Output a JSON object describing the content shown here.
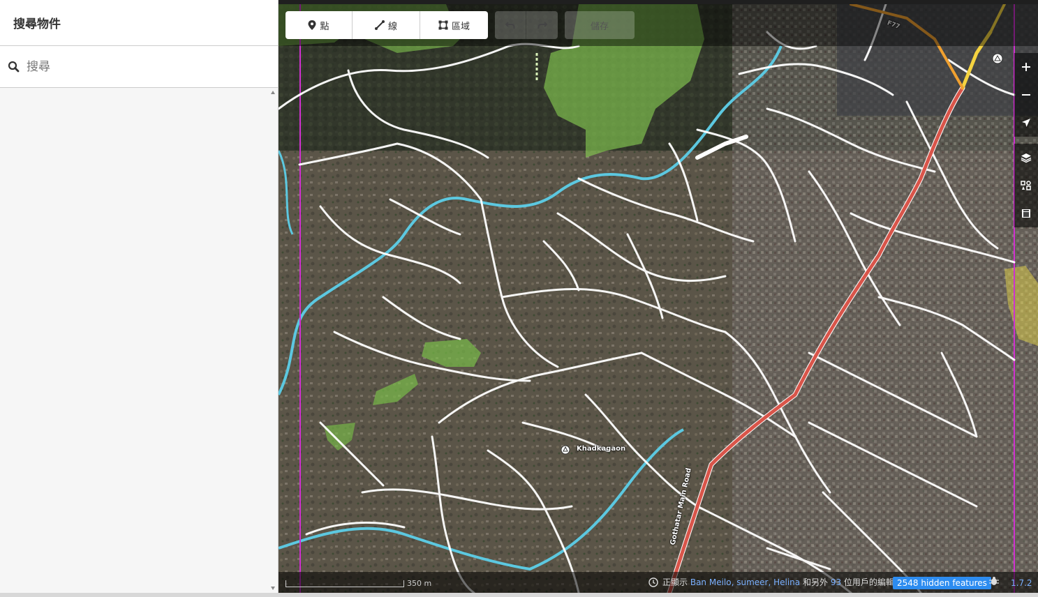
{
  "sidebar": {
    "title": "搜尋物件",
    "search_placeholder": "搜尋"
  },
  "toolbar": {
    "point_label": "點",
    "line_label": "線",
    "area_label": "區域",
    "save_label": "儲存"
  },
  "map": {
    "place_name": "Khadkagaon",
    "road_name": "Gothatar Main Road",
    "road_ref": "F77",
    "colors": {
      "primary_road": "#d9554a",
      "trunk_road": "#f5d340",
      "river": "#5cc8e0",
      "park": "#8bd354",
      "boundary": "#d030d0",
      "minor_road": "#ffffff"
    }
  },
  "footer": {
    "scale_label": "350 m",
    "attribution_prefix": "正顯示",
    "attribution_users": "Ban Meilo, sumeer, Helina",
    "attribution_middle": "和另外",
    "attribution_count": "93",
    "attribution_suffix": "位用戶的編輯",
    "hidden_features": "2548 hidden features",
    "version": "1.7.2"
  },
  "icons": {
    "search": "search-icon",
    "point": "point-icon",
    "line": "line-icon",
    "area": "area-icon",
    "undo": "undo-icon",
    "redo": "redo-icon",
    "zoom_in": "plus-icon",
    "zoom_out": "minus-icon",
    "locate": "location-arrow-icon",
    "layers": "layers-icon",
    "map_data": "map-data-icon",
    "help": "help-icon"
  }
}
